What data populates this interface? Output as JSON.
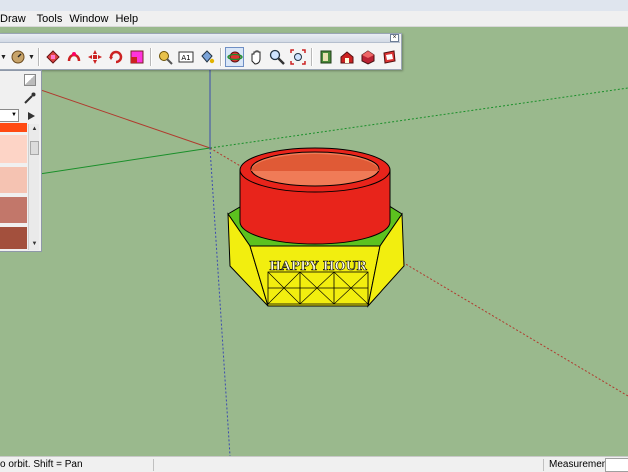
{
  "menubar": {
    "items": [
      "Draw",
      "Tools",
      "Window",
      "Help"
    ]
  },
  "toolbar": {
    "tools": [
      {
        "name": "orbit-tool",
        "icon": "orbit-icon"
      },
      {
        "name": "pan-tool",
        "icon": "pan-icon"
      },
      {
        "name": "zoom-tool",
        "icon": "zoom-icon"
      },
      {
        "name": "zoom-extents-tool",
        "icon": "zoom-extents-icon"
      }
    ],
    "dimension_label": "A1"
  },
  "model": {
    "label": "HAPPY HOUR"
  },
  "colors": {
    "viewport": "#9ab98d",
    "cylinder": "#e8241b",
    "cylinder_inner": "#f07b57",
    "nut_top": "#5cc21f",
    "nut_body": "#f2ee0f",
    "axis_red": "#b03a2e",
    "axis_green": "#1a8f2a",
    "axis_blue": "#3b4bb0"
  },
  "material_swatches": [
    "#ff4a12",
    "#fdd4c6",
    "#f5c3b2",
    "#c2776a",
    "#a3503d",
    "#8a3d29"
  ],
  "statusbar": {
    "hint": "o orbit.  Shift = Pan",
    "measurements_label": "Measurements"
  }
}
